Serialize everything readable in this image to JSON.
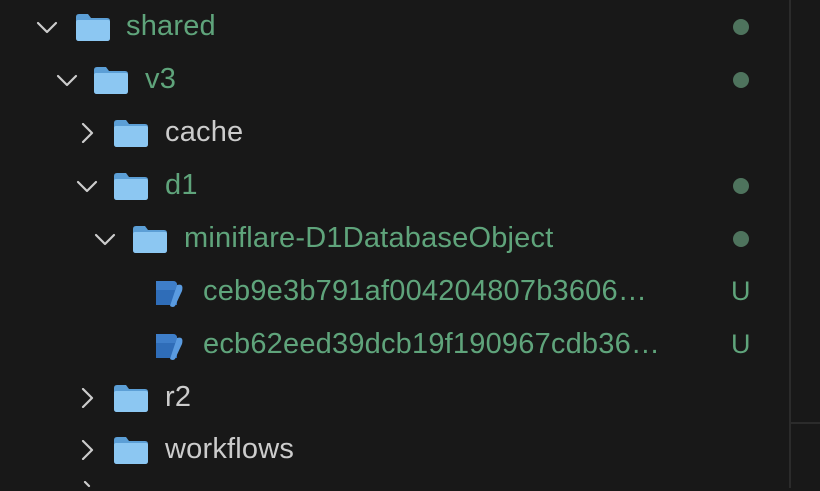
{
  "explorer": {
    "items": [
      {
        "label": "shared",
        "expanded": true,
        "type": "folder",
        "status": "modified",
        "status_text": ""
      },
      {
        "label": "v3",
        "expanded": true,
        "type": "folder",
        "status": "modified",
        "status_text": ""
      },
      {
        "label": "cache",
        "expanded": false,
        "type": "folder",
        "status": "none",
        "status_text": ""
      },
      {
        "label": "d1",
        "expanded": true,
        "type": "folder",
        "status": "modified",
        "status_text": ""
      },
      {
        "label": "miniflare-D1DatabaseObject",
        "expanded": true,
        "type": "folder",
        "status": "modified",
        "status_text": ""
      },
      {
        "label": "ceb9e3b791af004204807b3606…",
        "type": "file",
        "status": "untracked",
        "status_text": "U"
      },
      {
        "label": "ecb62eed39dcb19f190967cdb36…",
        "type": "file",
        "status": "untracked",
        "status_text": "U"
      },
      {
        "label": "r2",
        "expanded": false,
        "type": "folder",
        "status": "none",
        "status_text": ""
      },
      {
        "label": "workflows",
        "expanded": false,
        "type": "folder",
        "status": "none",
        "status_text": ""
      }
    ]
  },
  "colors": {
    "background": "#181818",
    "modified_text": "#5fa47b",
    "plain_text": "#cccccc",
    "modified_dot": "#4e735d",
    "folder_icon": "#7ab7e6",
    "file_icon": "#3b7fd0"
  },
  "icons": {
    "chevron_expanded": "chevron-down-icon",
    "chevron_collapsed": "chevron-right-icon",
    "folder": "folder-icon",
    "file": "database-file-icon"
  }
}
